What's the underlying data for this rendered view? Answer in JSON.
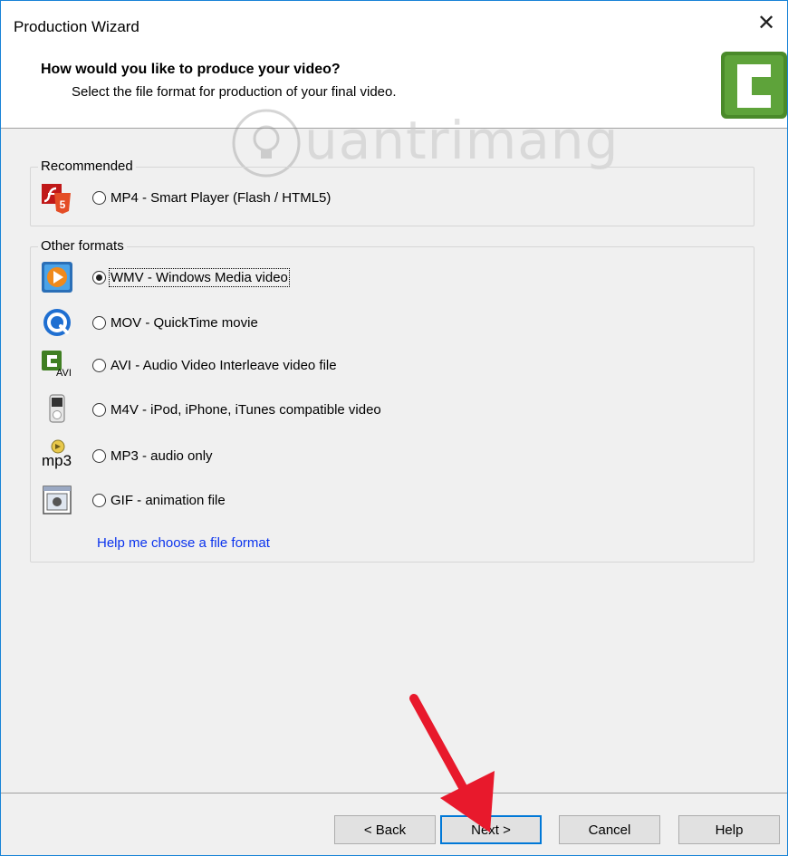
{
  "window": {
    "title": "Production Wizard",
    "close_glyph": "✕"
  },
  "header": {
    "title": "How would you like to produce your video?",
    "subtitle": "Select the file format for production of your final video.",
    "logo_icon": "camtasia-logo-icon"
  },
  "watermark": {
    "text": "uantrimang",
    "icon": "lightbulb-icon"
  },
  "recommended": {
    "legend": "Recommended",
    "options": [
      {
        "label": "MP4 - Smart Player (Flash / HTML5)",
        "icon": "flash-html5-icon",
        "selected": false
      }
    ]
  },
  "other": {
    "legend": "Other formats",
    "options": [
      {
        "label": "WMV - Windows Media video",
        "icon": "windows-media-icon",
        "selected": true
      },
      {
        "label": "MOV - QuickTime movie",
        "icon": "quicktime-icon",
        "selected": false
      },
      {
        "label": "AVI - Audio Video Interleave video file",
        "icon": "avi-icon",
        "selected": false,
        "icon_text": "AVI"
      },
      {
        "label": "M4V - iPod, iPhone, iTunes compatible video",
        "icon": "ipod-icon",
        "selected": false
      },
      {
        "label": "MP3 - audio only",
        "icon": "mp3-icon",
        "selected": false,
        "icon_text": "mp3"
      },
      {
        "label": "GIF - animation file",
        "icon": "gif-animation-icon",
        "selected": false
      }
    ],
    "help_link": "Help me choose a file format"
  },
  "footer": {
    "back": "< Back",
    "next": "Next >",
    "cancel": "Cancel",
    "help": "Help"
  },
  "colors": {
    "accent": "#0078d7",
    "link": "#0a33ee",
    "arrow": "#e8192c",
    "logo": "#4a8a2a"
  }
}
